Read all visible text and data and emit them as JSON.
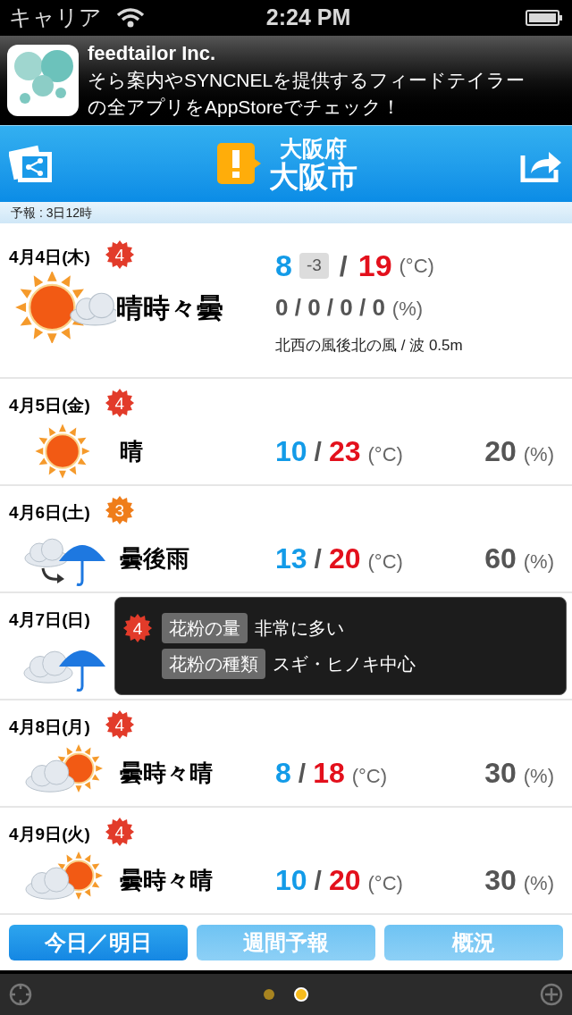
{
  "status_bar": {
    "carrier": "キャリア",
    "time": "2:24 PM"
  },
  "ad": {
    "title": "feedtailor Inc.",
    "text": "そら案内やSYNCNELを提供するフィードテイラーの全アプリをAppStoreでチェック！"
  },
  "header": {
    "prefecture": "大阪府",
    "city": "大阪市"
  },
  "forecast_time": "予報 : 3日12時",
  "today": {
    "date": "4月4日(木)",
    "pollen": {
      "level": "4",
      "color": "#e23b2a"
    },
    "weather_icon": {
      "kind": "sun_cloud"
    },
    "condition": "晴時々曇",
    "low": "8",
    "diff": "-3",
    "separator": "/",
    "high": "19",
    "temp_unit": "(°C)",
    "rain": "0 / 0 / 0 / 0",
    "rain_unit": "(%)",
    "wind": "北西の風後北の風 / 波 0.5m"
  },
  "days": [
    {
      "date": "4月5日(金)",
      "pollen": {
        "level": "4",
        "color": "#e23b2a"
      },
      "weather_icon": {
        "kind": "sun"
      },
      "condition": "晴",
      "low": "10",
      "separator": "/",
      "high": "23",
      "temp_unit": "(°C)",
      "rain": "20",
      "rain_unit": "(%)"
    },
    {
      "date": "4月6日(土)",
      "pollen": {
        "level": "3",
        "color": "#ef7d1a"
      },
      "weather_icon": {
        "kind": "cloud_then_rain"
      },
      "condition": "曇後雨",
      "low": "13",
      "separator": "/",
      "high": "20",
      "temp_unit": "(°C)",
      "rain": "60",
      "rain_unit": "(%)"
    },
    {
      "date": "4月7日(日)",
      "weather_icon": {
        "kind": "cloud_rain"
      }
    },
    {
      "date": "4月8日(月)",
      "pollen": {
        "level": "4",
        "color": "#e23b2a"
      },
      "weather_icon": {
        "kind": "cloud_sun"
      },
      "condition": "曇時々晴",
      "low": "8",
      "separator": "/",
      "high": "18",
      "temp_unit": "(°C)",
      "rain": "30",
      "rain_unit": "(%)"
    },
    {
      "date": "4月9日(火)",
      "pollen": {
        "level": "4",
        "color": "#e23b2a"
      },
      "weather_icon": {
        "kind": "cloud_sun"
      },
      "condition": "曇時々晴",
      "low": "10",
      "separator": "/",
      "high": "20",
      "temp_unit": "(°C)",
      "rain": "30",
      "rain_unit": "(%)"
    }
  ],
  "pollen_popup": {
    "level": "4",
    "color": "#e23b2a",
    "rows": [
      {
        "label": "花粉の量",
        "value": "非常に多い"
      },
      {
        "label": "花粉の種類",
        "value": "スギ・ヒノキ中心"
      }
    ]
  },
  "tabs": [
    {
      "label": "今日／明日",
      "selected": true
    },
    {
      "label": "週間予報",
      "selected": false
    },
    {
      "label": "概況",
      "selected": false
    }
  ],
  "page_dots": [
    {
      "selected": false
    },
    {
      "selected": true
    }
  ]
}
